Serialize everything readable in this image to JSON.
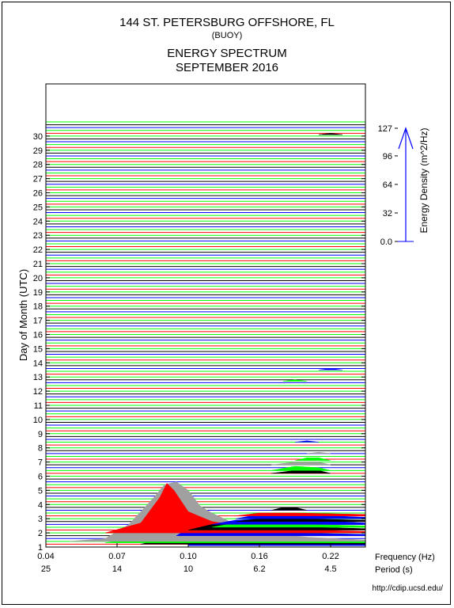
{
  "header": {
    "station": "144 ST. PETERSBURG OFFSHORE, FL",
    "type": "(BUOY)",
    "title": "ENERGY SPECTRUM",
    "month": "SEPTEMBER 2016"
  },
  "footer": {
    "url": "http://cdip.ucsd.edu/"
  },
  "chart_data": {
    "type": "area",
    "title": "ENERGY SPECTRUM",
    "ylabel": "Day of Month (UTC)",
    "xlabel_frequency": "Frequency (Hz)",
    "xlabel_period": "Period (s)",
    "x_ticks_frequency": [
      "0.04",
      "0.07",
      "0.10",
      "0.16",
      "0.22"
    ],
    "x_ticks_period": [
      "25",
      "14",
      "10",
      "6.2",
      "4.5"
    ],
    "x_tick_values": [
      0.04,
      0.07,
      0.1,
      0.16,
      0.22
    ],
    "xlim": [
      0.04,
      0.25
    ],
    "y_ticks": [
      "1",
      "2",
      "3",
      "4",
      "5",
      "6",
      "7",
      "8",
      "9",
      "10",
      "11",
      "12",
      "13",
      "14",
      "15",
      "16",
      "17",
      "18",
      "19",
      "20",
      "21",
      "22",
      "23",
      "24",
      "25",
      "26",
      "27",
      "28",
      "29",
      "30"
    ],
    "ylim": [
      1,
      31.5
    ],
    "colorbar": {
      "label": "Energy Density (m^2/Hz)",
      "ticks": [
        "127",
        "96",
        "64",
        "32",
        "0.0"
      ],
      "tick_values": [
        127,
        96,
        64,
        32,
        0
      ],
      "max": 127
    },
    "colors": {
      "red": "#ff0000",
      "green": "#00ff00",
      "blue": "#0000ff",
      "black": "#000000",
      "gray": "#a0a0a0"
    },
    "series": [
      {
        "day": 1.1,
        "color": "#0000ff",
        "points": [
          [
            0.1,
            0
          ],
          [
            0.102,
            1.2
          ],
          [
            0.115,
            2.0
          ],
          [
            0.13,
            1.0
          ],
          [
            0.16,
            0.4
          ],
          [
            0.2,
            0.2
          ],
          [
            0.25,
            0.1
          ]
        ]
      },
      {
        "day": 1.2,
        "color": "#000000",
        "points": [
          [
            0.08,
            0
          ],
          [
            0.09,
            0.4
          ],
          [
            0.098,
            1.1
          ],
          [
            0.105,
            0.5
          ],
          [
            0.115,
            0.8
          ],
          [
            0.13,
            0.5
          ],
          [
            0.16,
            0.2
          ],
          [
            0.25,
            0.1
          ]
        ]
      },
      {
        "day": 1.3,
        "color": "#00ff00",
        "points": [
          [
            0.065,
            0
          ],
          [
            0.08,
            0.3
          ],
          [
            0.095,
            1.2
          ],
          [
            0.11,
            1.6
          ],
          [
            0.125,
            1.5
          ],
          [
            0.14,
            1.0
          ],
          [
            0.16,
            0.5
          ],
          [
            0.2,
            0.2
          ],
          [
            0.25,
            0.1
          ]
        ]
      },
      {
        "day": 1.4,
        "color": "#a0a0a0",
        "points": [
          [
            0.05,
            0
          ],
          [
            0.065,
            0.2
          ],
          [
            0.075,
            1.2
          ],
          [
            0.085,
            3.0
          ],
          [
            0.09,
            4.0
          ],
          [
            0.095,
            4.2
          ],
          [
            0.1,
            3.6
          ],
          [
            0.11,
            2.5
          ],
          [
            0.12,
            2.0
          ],
          [
            0.14,
            1.2
          ],
          [
            0.16,
            0.6
          ],
          [
            0.2,
            0.3
          ],
          [
            0.25,
            0.1
          ]
        ]
      },
      {
        "day": 1.8,
        "color": "#0000ff",
        "points": [
          [
            0.095,
            0
          ],
          [
            0.1,
            0.5
          ],
          [
            0.12,
            0.6
          ],
          [
            0.14,
            0.4
          ],
          [
            0.16,
            0.3
          ],
          [
            0.19,
            0.2
          ],
          [
            0.25,
            0.1
          ]
        ]
      },
      {
        "day": 2.0,
        "color": "#ff0000",
        "points": [
          [
            0.065,
            0
          ],
          [
            0.08,
            0.7
          ],
          [
            0.088,
            2.5
          ],
          [
            0.091,
            3.5
          ],
          [
            0.094,
            3.0
          ],
          [
            0.1,
            1.5
          ],
          [
            0.12,
            0.8
          ],
          [
            0.15,
            0.4
          ],
          [
            0.2,
            0.2
          ],
          [
            0.25,
            0.1
          ]
        ]
      },
      {
        "day": 2.2,
        "color": "#000000",
        "points": [
          [
            0.1,
            0
          ],
          [
            0.12,
            0.4
          ],
          [
            0.14,
            0.5
          ],
          [
            0.16,
            0.4
          ],
          [
            0.2,
            0.2
          ],
          [
            0.25,
            0.1
          ]
        ]
      },
      {
        "day": 2.4,
        "color": "#00ff00",
        "points": [
          [
            0.12,
            0
          ],
          [
            0.14,
            0.3
          ],
          [
            0.16,
            0.3
          ],
          [
            0.2,
            0.2
          ],
          [
            0.25,
            0.1
          ]
        ]
      },
      {
        "day": 2.6,
        "color": "#0000ff",
        "points": [
          [
            0.12,
            0
          ],
          [
            0.14,
            0.3
          ],
          [
            0.16,
            0.4
          ],
          [
            0.2,
            0.3
          ],
          [
            0.25,
            0.1
          ]
        ]
      },
      {
        "day": 2.8,
        "color": "#000000",
        "points": [
          [
            0.14,
            0
          ],
          [
            0.16,
            0.2
          ],
          [
            0.19,
            0.2
          ],
          [
            0.25,
            0.1
          ]
        ]
      },
      {
        "day": 3.0,
        "color": "#0000ff",
        "points": [
          [
            0.14,
            0
          ],
          [
            0.16,
            0.3
          ],
          [
            0.19,
            0.3
          ],
          [
            0.25,
            0.1
          ]
        ]
      },
      {
        "day": 3.2,
        "color": "#ff0000",
        "points": [
          [
            0.14,
            0
          ],
          [
            0.16,
            0.2
          ],
          [
            0.19,
            0.2
          ],
          [
            0.25,
            0.1
          ]
        ]
      },
      {
        "day": 3.6,
        "color": "#000000",
        "points": [
          [
            0.17,
            0
          ],
          [
            0.18,
            0.2
          ],
          [
            0.19,
            0.2
          ],
          [
            0.2,
            0
          ]
        ]
      },
      {
        "day": 6.2,
        "color": "#000000",
        "points": [
          [
            0.17,
            0
          ],
          [
            0.19,
            0.2
          ],
          [
            0.21,
            0.2
          ],
          [
            0.22,
            0
          ]
        ]
      },
      {
        "day": 6.4,
        "color": "#00ff00",
        "points": [
          [
            0.17,
            0
          ],
          [
            0.19,
            0.3
          ],
          [
            0.21,
            0.2
          ],
          [
            0.22,
            0
          ]
        ]
      },
      {
        "day": 6.8,
        "color": "#a0a0a0",
        "points": [
          [
            0.17,
            0
          ],
          [
            0.19,
            0.2
          ],
          [
            0.21,
            0.2
          ],
          [
            0.22,
            0
          ]
        ]
      },
      {
        "day": 7.1,
        "color": "#00ff00",
        "points": [
          [
            0.19,
            0
          ],
          [
            0.2,
            0.2
          ],
          [
            0.21,
            0.2
          ],
          [
            0.22,
            0
          ]
        ]
      },
      {
        "day": 7.6,
        "color": "#a0a0a0",
        "points": [
          [
            0.2,
            0
          ],
          [
            0.21,
            0.1
          ],
          [
            0.22,
            0
          ]
        ]
      },
      {
        "day": 8.4,
        "color": "#0000ff",
        "points": [
          [
            0.19,
            0
          ],
          [
            0.2,
            0.1
          ],
          [
            0.21,
            0
          ]
        ]
      },
      {
        "day": 12.7,
        "color": "#00ff00",
        "points": [
          [
            0.18,
            0
          ],
          [
            0.19,
            0.1
          ],
          [
            0.2,
            0
          ]
        ]
      },
      {
        "day": 13.5,
        "color": "#0000ff",
        "points": [
          [
            0.21,
            0
          ],
          [
            0.22,
            0.1
          ],
          [
            0.23,
            0
          ]
        ]
      },
      {
        "day": 30.1,
        "color": "#000000",
        "points": [
          [
            0.21,
            0
          ],
          [
            0.22,
            0.1
          ],
          [
            0.23,
            0
          ]
        ]
      }
    ]
  }
}
